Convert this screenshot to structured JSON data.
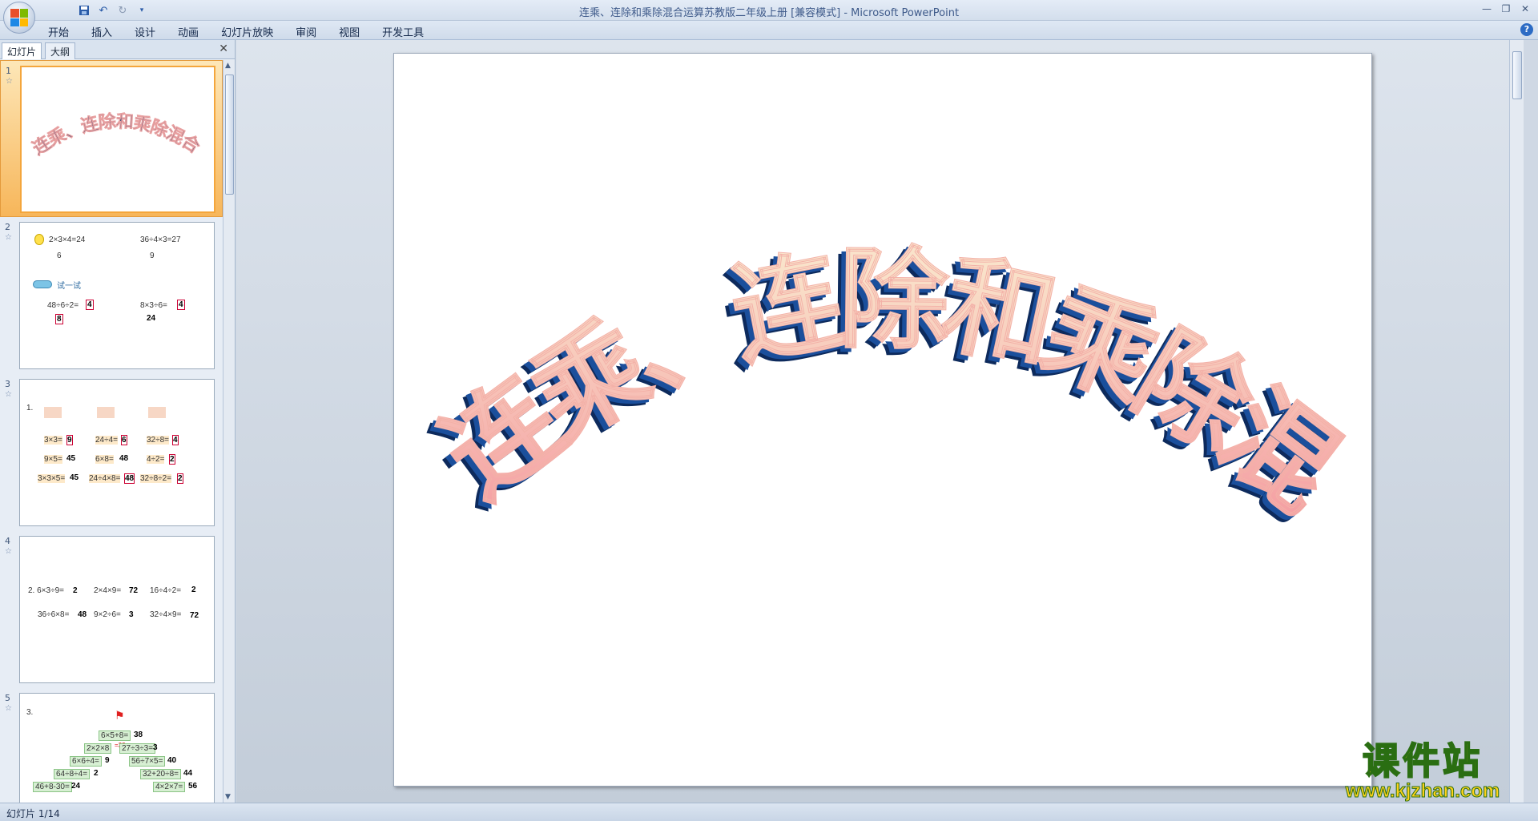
{
  "window": {
    "title": "连乘、连除和乘除混合运算苏教版二年级上册 [兼容模式] - Microsoft PowerPoint"
  },
  "ribbon": {
    "tabs": [
      "开始",
      "插入",
      "设计",
      "动画",
      "幻灯片放映",
      "审阅",
      "视图",
      "开发工具"
    ]
  },
  "left_pane": {
    "tab_slides": "幻灯片",
    "tab_outline": "大纲",
    "thumbnails": [
      {
        "num": "1",
        "title": "连乘、连除和乘除混合运算"
      },
      {
        "num": "2",
        "lines": [
          "2×3×4=24",
          "6",
          "36÷4×3=27",
          "9",
          "试一试",
          "48÷6÷2=",
          "4",
          "8",
          "8×3÷6=",
          "4",
          "24"
        ]
      },
      {
        "num": "3",
        "lines": [
          "1.",
          "3×3=",
          "9",
          "24÷4=",
          "6",
          "32÷8=",
          "4",
          "9×5=",
          "45",
          "6×8=",
          "48",
          "4÷2=",
          "2",
          "3×3×5=",
          "45",
          "24÷4×8=",
          "48",
          "32÷8÷2=",
          "2"
        ]
      },
      {
        "num": "4",
        "lines": [
          "2. 6×3÷9=",
          "2",
          "2×4×9=",
          "72",
          "16÷4÷2=",
          "2",
          "36÷6×8=",
          "48",
          "9×2÷6=",
          "3",
          "32÷4×9=",
          "72"
        ]
      },
      {
        "num": "5",
        "lines": [
          "3.",
          "6×5+8=",
          "38",
          "2×2×8",
          "=32",
          "27÷3÷3=",
          "3",
          "6×6÷4=",
          "9",
          "56÷7×5=",
          "40",
          "64÷8÷4=",
          "2",
          "32+20÷8=",
          "44",
          "46+8-30=",
          "24",
          "4×2×7=",
          "56"
        ]
      }
    ]
  },
  "slide": {
    "title": "连乘、连除和乘除混合运算"
  },
  "status": {
    "slide_indicator": "幻灯片 1/14"
  },
  "watermark": {
    "cn": "课件站",
    "url": "www.kjzhan.com"
  }
}
